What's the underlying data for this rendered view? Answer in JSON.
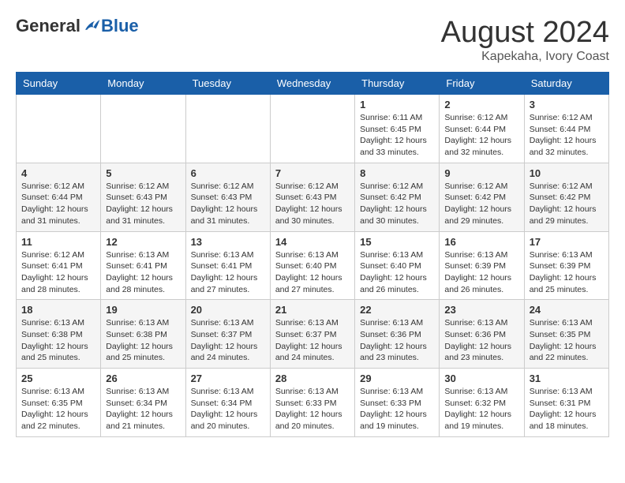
{
  "logo": {
    "general": "General",
    "blue": "Blue"
  },
  "title": "August 2024",
  "subtitle": "Kapekaha, Ivory Coast",
  "days_of_week": [
    "Sunday",
    "Monday",
    "Tuesday",
    "Wednesday",
    "Thursday",
    "Friday",
    "Saturday"
  ],
  "weeks": [
    [
      {
        "day": "",
        "info": ""
      },
      {
        "day": "",
        "info": ""
      },
      {
        "day": "",
        "info": ""
      },
      {
        "day": "",
        "info": ""
      },
      {
        "day": "1",
        "info": "Sunrise: 6:11 AM\nSunset: 6:45 PM\nDaylight: 12 hours\nand 33 minutes."
      },
      {
        "day": "2",
        "info": "Sunrise: 6:12 AM\nSunset: 6:44 PM\nDaylight: 12 hours\nand 32 minutes."
      },
      {
        "day": "3",
        "info": "Sunrise: 6:12 AM\nSunset: 6:44 PM\nDaylight: 12 hours\nand 32 minutes."
      }
    ],
    [
      {
        "day": "4",
        "info": "Sunrise: 6:12 AM\nSunset: 6:44 PM\nDaylight: 12 hours\nand 31 minutes."
      },
      {
        "day": "5",
        "info": "Sunrise: 6:12 AM\nSunset: 6:43 PM\nDaylight: 12 hours\nand 31 minutes."
      },
      {
        "day": "6",
        "info": "Sunrise: 6:12 AM\nSunset: 6:43 PM\nDaylight: 12 hours\nand 31 minutes."
      },
      {
        "day": "7",
        "info": "Sunrise: 6:12 AM\nSunset: 6:43 PM\nDaylight: 12 hours\nand 30 minutes."
      },
      {
        "day": "8",
        "info": "Sunrise: 6:12 AM\nSunset: 6:42 PM\nDaylight: 12 hours\nand 30 minutes."
      },
      {
        "day": "9",
        "info": "Sunrise: 6:12 AM\nSunset: 6:42 PM\nDaylight: 12 hours\nand 29 minutes."
      },
      {
        "day": "10",
        "info": "Sunrise: 6:12 AM\nSunset: 6:42 PM\nDaylight: 12 hours\nand 29 minutes."
      }
    ],
    [
      {
        "day": "11",
        "info": "Sunrise: 6:12 AM\nSunset: 6:41 PM\nDaylight: 12 hours\nand 28 minutes."
      },
      {
        "day": "12",
        "info": "Sunrise: 6:13 AM\nSunset: 6:41 PM\nDaylight: 12 hours\nand 28 minutes."
      },
      {
        "day": "13",
        "info": "Sunrise: 6:13 AM\nSunset: 6:41 PM\nDaylight: 12 hours\nand 27 minutes."
      },
      {
        "day": "14",
        "info": "Sunrise: 6:13 AM\nSunset: 6:40 PM\nDaylight: 12 hours\nand 27 minutes."
      },
      {
        "day": "15",
        "info": "Sunrise: 6:13 AM\nSunset: 6:40 PM\nDaylight: 12 hours\nand 26 minutes."
      },
      {
        "day": "16",
        "info": "Sunrise: 6:13 AM\nSunset: 6:39 PM\nDaylight: 12 hours\nand 26 minutes."
      },
      {
        "day": "17",
        "info": "Sunrise: 6:13 AM\nSunset: 6:39 PM\nDaylight: 12 hours\nand 25 minutes."
      }
    ],
    [
      {
        "day": "18",
        "info": "Sunrise: 6:13 AM\nSunset: 6:38 PM\nDaylight: 12 hours\nand 25 minutes."
      },
      {
        "day": "19",
        "info": "Sunrise: 6:13 AM\nSunset: 6:38 PM\nDaylight: 12 hours\nand 25 minutes."
      },
      {
        "day": "20",
        "info": "Sunrise: 6:13 AM\nSunset: 6:37 PM\nDaylight: 12 hours\nand 24 minutes."
      },
      {
        "day": "21",
        "info": "Sunrise: 6:13 AM\nSunset: 6:37 PM\nDaylight: 12 hours\nand 24 minutes."
      },
      {
        "day": "22",
        "info": "Sunrise: 6:13 AM\nSunset: 6:36 PM\nDaylight: 12 hours\nand 23 minutes."
      },
      {
        "day": "23",
        "info": "Sunrise: 6:13 AM\nSunset: 6:36 PM\nDaylight: 12 hours\nand 23 minutes."
      },
      {
        "day": "24",
        "info": "Sunrise: 6:13 AM\nSunset: 6:35 PM\nDaylight: 12 hours\nand 22 minutes."
      }
    ],
    [
      {
        "day": "25",
        "info": "Sunrise: 6:13 AM\nSunset: 6:35 PM\nDaylight: 12 hours\nand 22 minutes."
      },
      {
        "day": "26",
        "info": "Sunrise: 6:13 AM\nSunset: 6:34 PM\nDaylight: 12 hours\nand 21 minutes."
      },
      {
        "day": "27",
        "info": "Sunrise: 6:13 AM\nSunset: 6:34 PM\nDaylight: 12 hours\nand 20 minutes."
      },
      {
        "day": "28",
        "info": "Sunrise: 6:13 AM\nSunset: 6:33 PM\nDaylight: 12 hours\nand 20 minutes."
      },
      {
        "day": "29",
        "info": "Sunrise: 6:13 AM\nSunset: 6:33 PM\nDaylight: 12 hours\nand 19 minutes."
      },
      {
        "day": "30",
        "info": "Sunrise: 6:13 AM\nSunset: 6:32 PM\nDaylight: 12 hours\nand 19 minutes."
      },
      {
        "day": "31",
        "info": "Sunrise: 6:13 AM\nSunset: 6:31 PM\nDaylight: 12 hours\nand 18 minutes."
      }
    ]
  ]
}
